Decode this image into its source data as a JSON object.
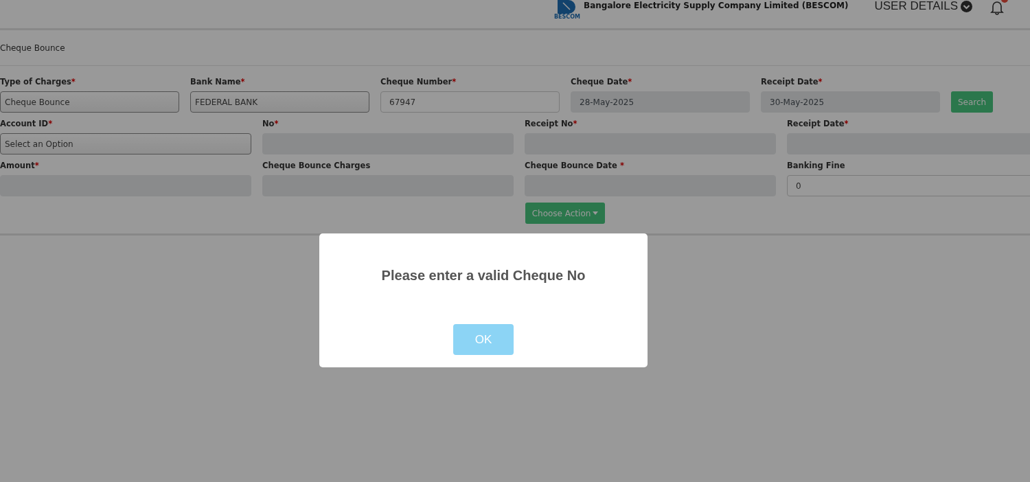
{
  "header": {
    "logo_text": "BESCOM",
    "title": "Bangalore Electricity Supply Company Limited (BESCOM)",
    "user_menu": "USER DETAILS",
    "notifications": {
      "has_unread": true
    }
  },
  "section_title": "Cheque Bounce",
  "form_rows": [
    {
      "fields": [
        {
          "label": "Type of Charges",
          "required_mark": "*",
          "kind": "select",
          "value": "Cheque Bounce",
          "disabled": false
        },
        {
          "label": "Bank Name",
          "required_mark": "*",
          "kind": "select",
          "value": "FEDERAL BANK",
          "disabled": false
        },
        {
          "label": "Cheque Number",
          "required_mark": "*",
          "kind": "input",
          "value": "67947",
          "disabled": false
        },
        {
          "label": "Cheque Date",
          "required_mark": "*",
          "kind": "input",
          "value": "28-May-2025",
          "disabled": true
        },
        {
          "label": "Receipt Date",
          "required_mark": "*",
          "kind": "input",
          "value": "30-May-2025",
          "disabled": true
        }
      ],
      "button": "Search"
    },
    {
      "fields": [
        {
          "label": "Account ID",
          "required_mark": "*",
          "kind": "select",
          "value": "Select an Option",
          "disabled": false
        },
        {
          "label": "No",
          "required_mark": "*",
          "kind": "input",
          "disabled": true
        },
        {
          "label": "Receipt No",
          "required_mark": "*",
          "kind": "input",
          "disabled": true
        },
        {
          "label": "Receipt Date",
          "required_mark": "*",
          "kind": "input",
          "disabled": true
        }
      ]
    },
    {
      "fields": [
        {
          "label": "Amount",
          "required_mark": "*",
          "kind": "input",
          "disabled": true
        },
        {
          "label": "Cheque Bounce Charges",
          "kind": "input",
          "disabled": true
        },
        {
          "label": "Cheque Bounce Date ",
          "required_mark": "*",
          "kind": "input",
          "disabled": true
        },
        {
          "label": "Banking Fine",
          "kind": "input",
          "value": "0",
          "disabled": false
        }
      ]
    }
  ],
  "action_button": "Choose Action",
  "dialog": {
    "message": "Please enter a valid Cheque No",
    "button": "OK"
  }
}
